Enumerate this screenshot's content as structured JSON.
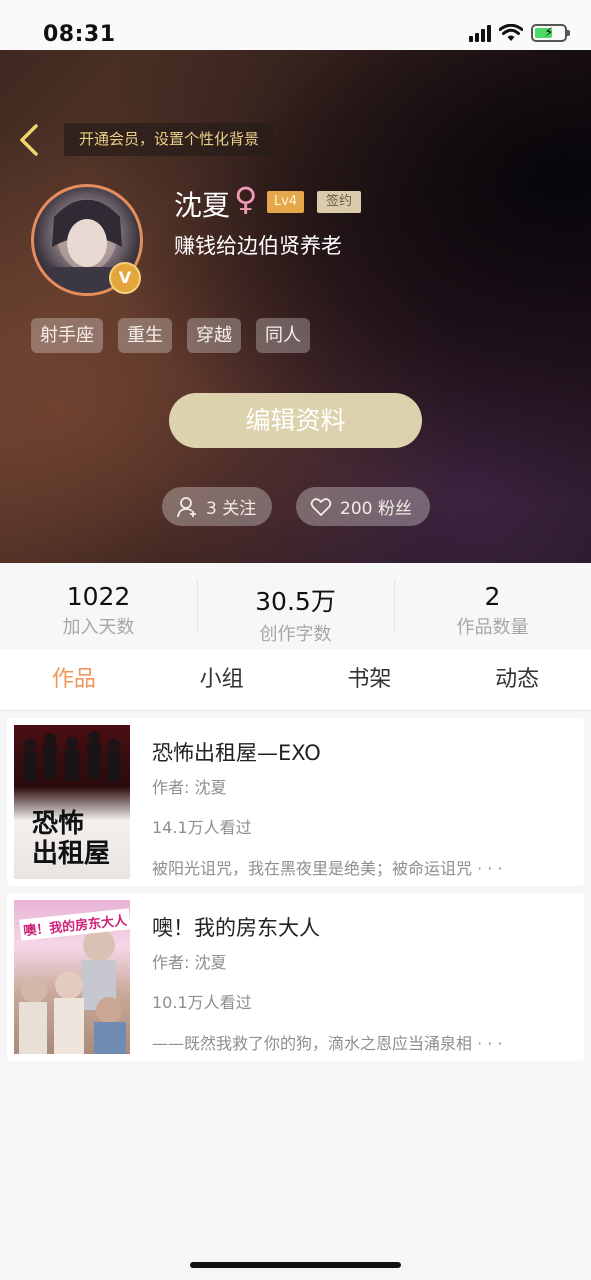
{
  "status_bar": {
    "time": "08:31"
  },
  "header": {
    "vip_tip": "开通会员，设置个性化背景",
    "username": "沈夏",
    "gender_symbol": "♀",
    "level": "Lv4",
    "sign_badge": "签约",
    "bio": "赚钱给边伯贤养老",
    "verified_badge": "V",
    "tags": [
      "射手座",
      "重生",
      "穿越",
      "同人"
    ],
    "edit_button": "编辑资料",
    "follow_label": "3 关注",
    "fans_label": "200 粉丝"
  },
  "stats": [
    {
      "value": "1022",
      "label": "加入天数"
    },
    {
      "value": "30.5万",
      "label": "创作字数"
    },
    {
      "value": "2",
      "label": "作品数量"
    }
  ],
  "tabs": [
    {
      "label": "作品",
      "active": true
    },
    {
      "label": "小组",
      "active": false
    },
    {
      "label": "书架",
      "active": false
    },
    {
      "label": "动态",
      "active": false
    }
  ],
  "works": [
    {
      "title": "恐怖出租屋—EXO",
      "author": "作者: 沈夏",
      "views": "14.1万人看过",
      "desc": "被阳光诅咒，我在黑夜里是绝美；被命运诅咒 · · ·",
      "cover_text": "恐怖\n出租屋"
    },
    {
      "title": "噢！我的房东大人",
      "author": "作者: 沈夏",
      "views": "10.1万人看过",
      "desc": "——既然我救了你的狗，滴水之恩应当涌泉相 · · ·",
      "cover_text": "噢！我的房东大人"
    }
  ],
  "colors": {
    "accent": "#f0975a",
    "level": "#e6a74a",
    "edit_button": "#ddd2ae"
  }
}
